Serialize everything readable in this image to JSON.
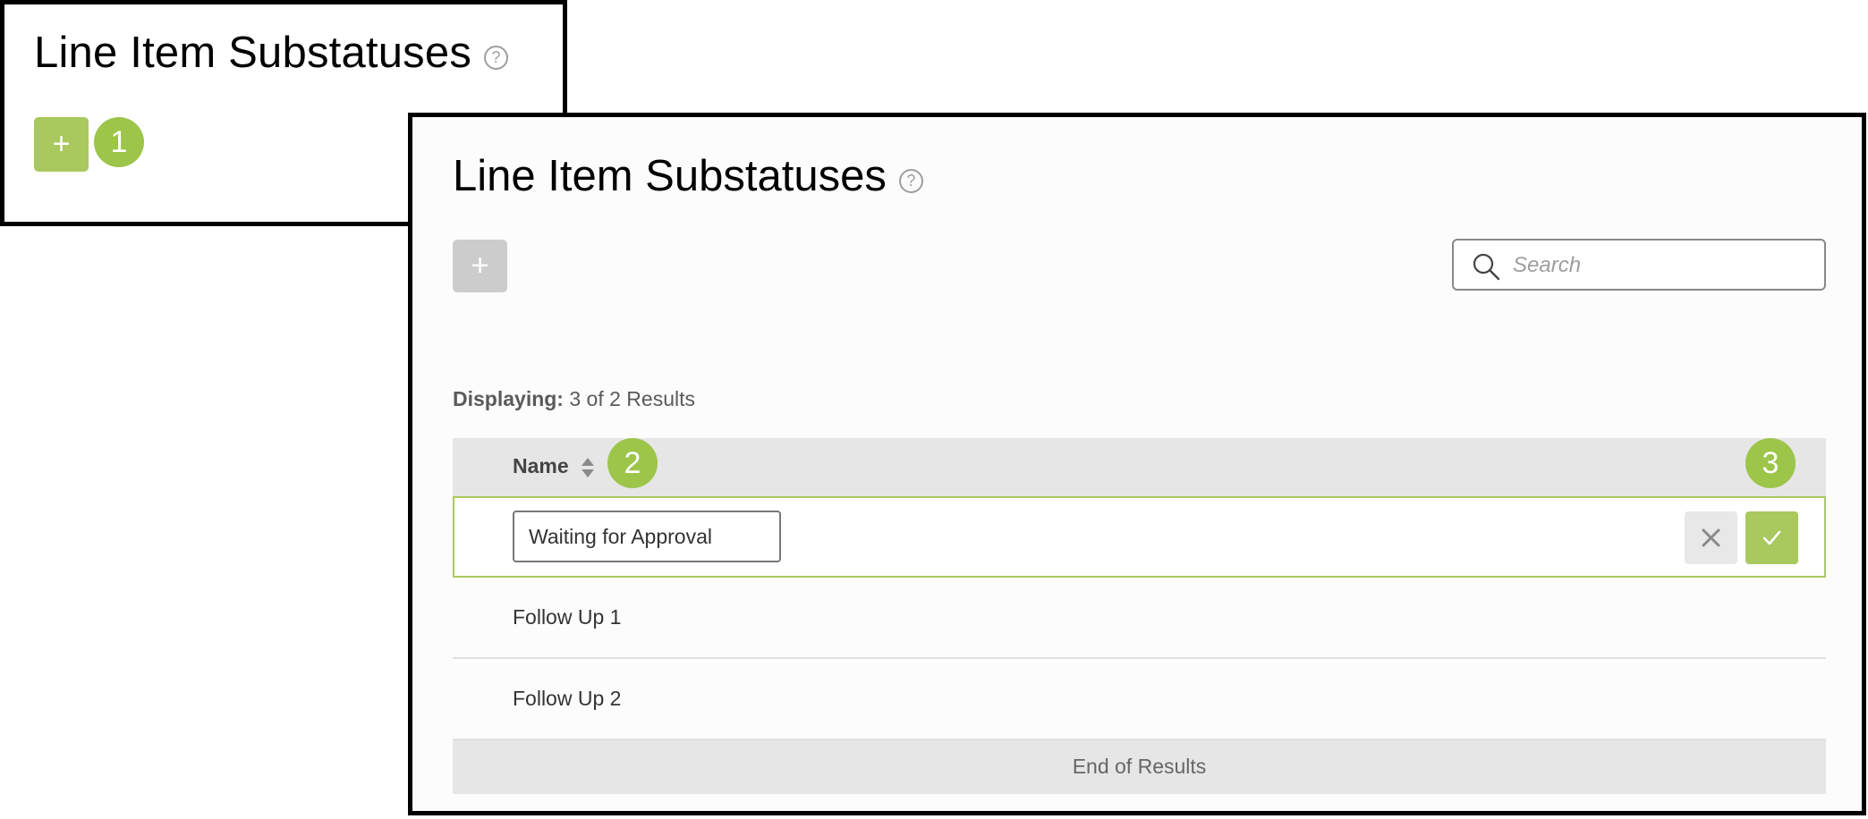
{
  "panel1": {
    "title": "Line Item Substatuses",
    "help_glyph": "?",
    "add_glyph": "+"
  },
  "panel2": {
    "title": "Line Item Substatuses",
    "help_glyph": "?",
    "add_glyph": "+",
    "search": {
      "placeholder": "Search",
      "value": ""
    },
    "displaying_label": "Displaying:",
    "displaying_value": "3 of 2 Results",
    "table": {
      "column_name": "Name",
      "edit_row_value": "Waiting for Approval",
      "rows": [
        {
          "name": "Follow Up 1"
        },
        {
          "name": "Follow Up 2"
        }
      ],
      "footer": "End of Results"
    }
  },
  "markers": [
    "1",
    "2",
    "3"
  ],
  "colors": {
    "accent": "#a9c95f",
    "marker": "#9cc54a",
    "disabled": "#cccccc",
    "header_bg": "#e6e6e6"
  },
  "icons": [
    "help-icon",
    "plus-icon",
    "search-icon",
    "sort-icon",
    "close-icon",
    "check-icon"
  ]
}
